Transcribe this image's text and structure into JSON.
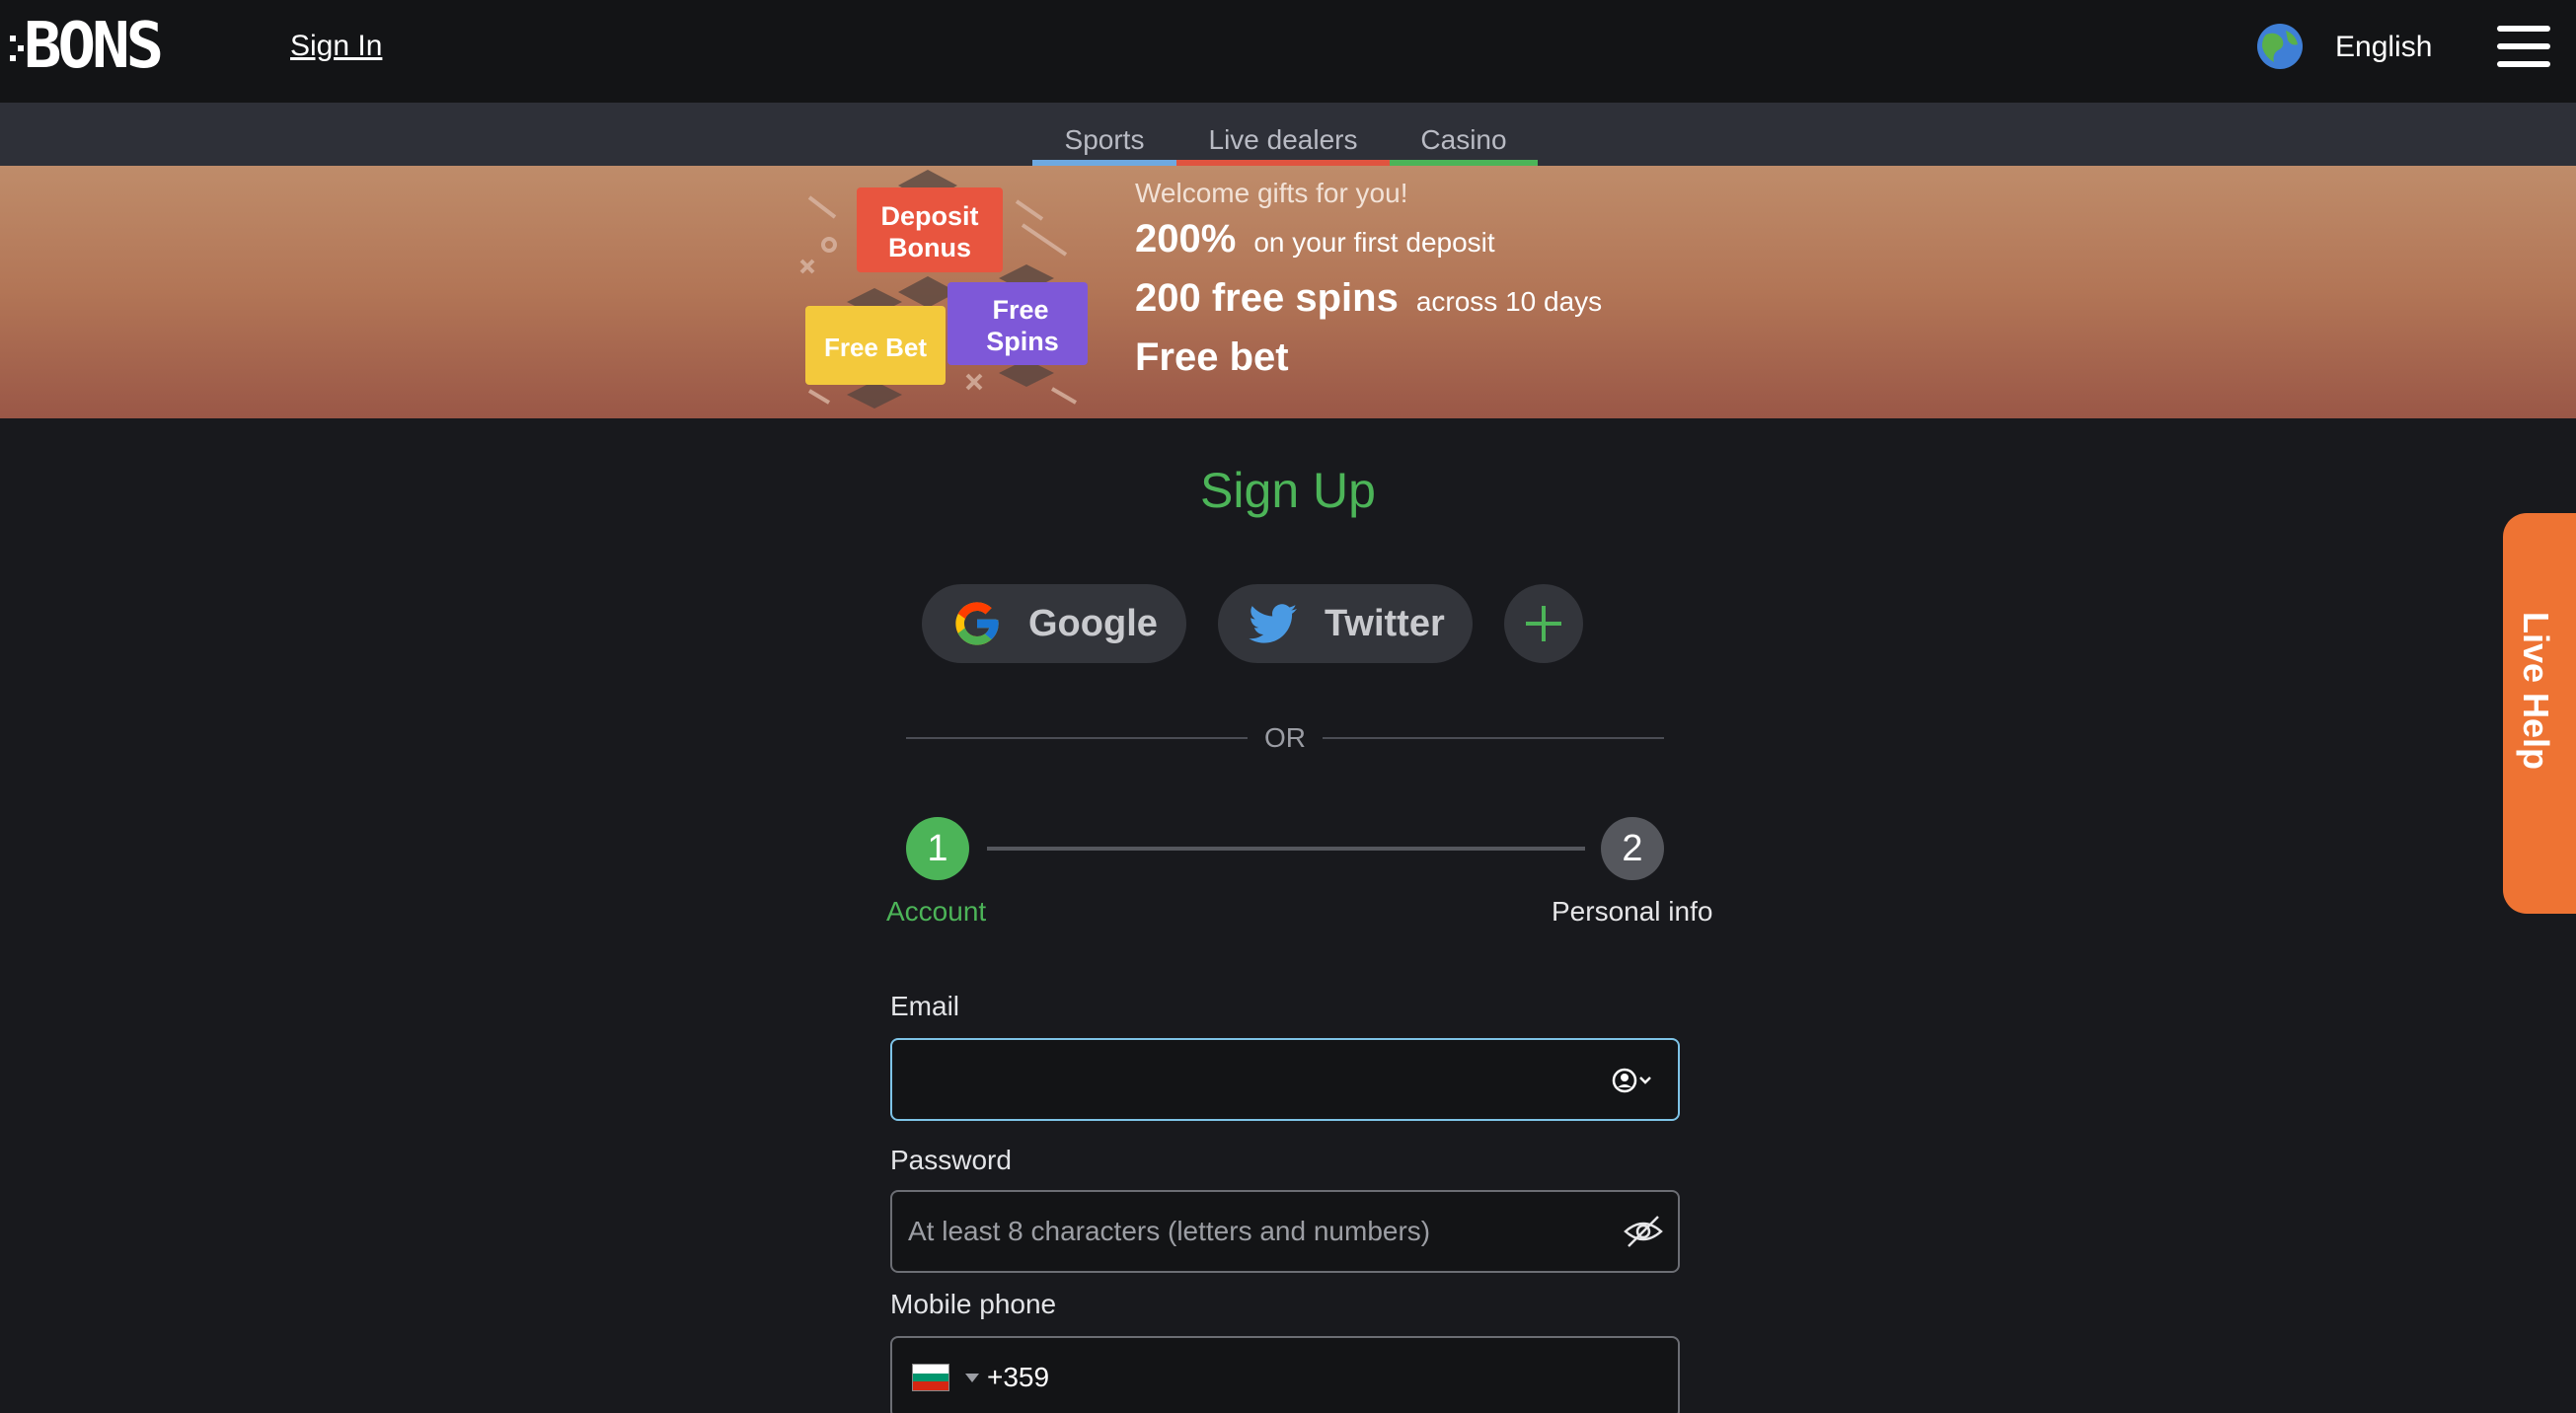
{
  "header": {
    "logo_text": "BONS",
    "signin_label": "Sign In",
    "language": "English",
    "menu_icon": "hamburger-icon"
  },
  "tabs": [
    {
      "label": "Sports",
      "color": "#6ea9e0"
    },
    {
      "label": "Live dealers",
      "color": "#e0543f"
    },
    {
      "label": "Casino",
      "color": "#4cb458"
    }
  ],
  "banner": {
    "art_labels": {
      "deposit": "Deposit Bonus",
      "spins": "Free Spins",
      "bet": "Free Bet"
    },
    "welcome": "Welcome gifts for you!",
    "offers": [
      {
        "big": "200%",
        "small": "on your first deposit"
      },
      {
        "big": "200 free spins",
        "small": "across 10 days"
      },
      {
        "big": "Free bet",
        "small": ""
      }
    ]
  },
  "signup": {
    "title": "Sign Up",
    "social": {
      "google": "Google",
      "twitter": "Twitter"
    },
    "or_text": "OR",
    "steps": [
      {
        "number": "1",
        "label": "Account"
      },
      {
        "number": "2",
        "label": "Personal info"
      }
    ],
    "current_step": 1
  },
  "form": {
    "email_label": "Email",
    "email_value": "",
    "password_label": "Password",
    "password_placeholder": "At least 8 characters (letters and numbers)",
    "phone_label": "Mobile phone",
    "phone_dial_code": "+359",
    "phone_country_flag_colors": [
      "#ffffff",
      "#00966e",
      "#d62612"
    ]
  },
  "live_help": "Live Help",
  "colors": {
    "accent_green": "#4cb458",
    "live_help_orange": "#ee7333",
    "email_focus_border": "#7ec3e6"
  }
}
